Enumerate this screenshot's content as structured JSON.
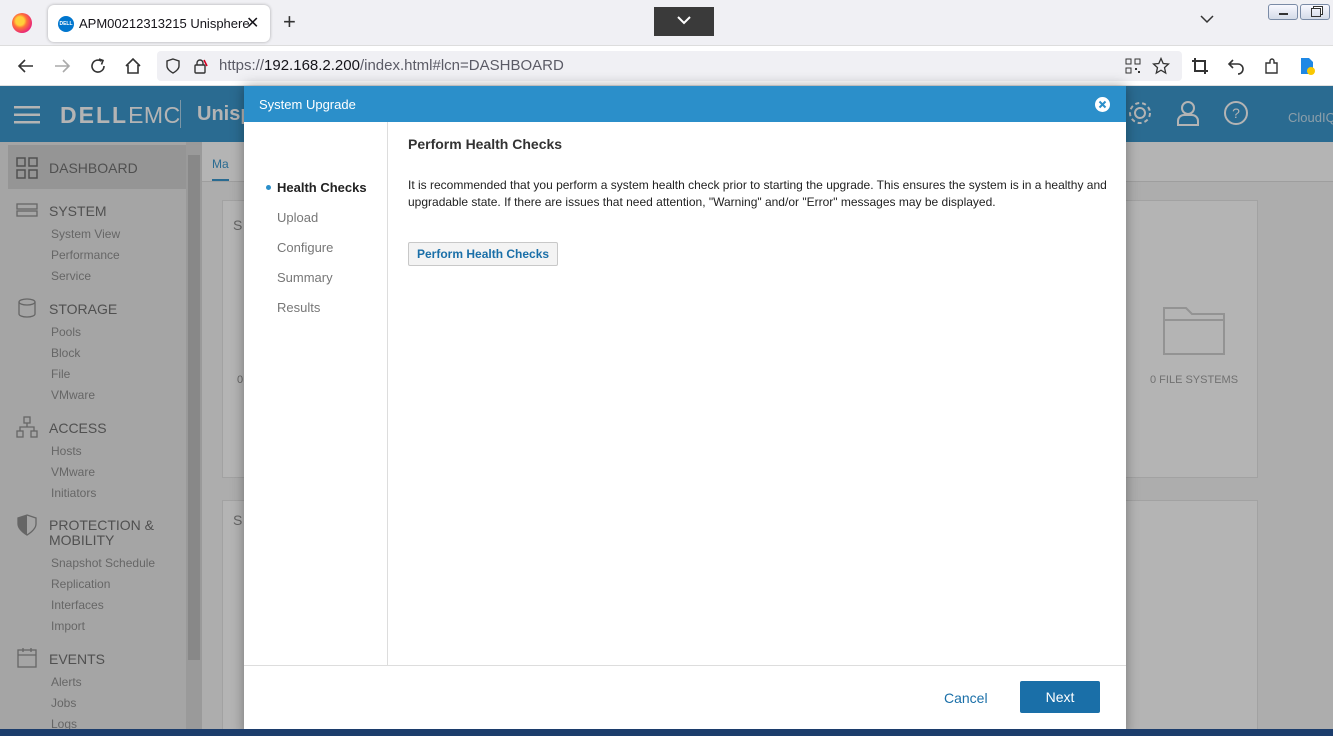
{
  "browser": {
    "tab_title": "APM00212313215 Unisphere",
    "tab_favicon_text": "DELL",
    "tab_close": "✕",
    "new_tab": "+",
    "url_prefix": "https://",
    "url_host": "192.168.2.200",
    "url_path": "/index.html#lcn=DASHBOARD"
  },
  "app": {
    "logo_bold": "DELL",
    "logo_light": "EMC",
    "title": "Unisp",
    "cloudiq": "CloudIQ",
    "main_tab": "Ma",
    "card_title_1": "S",
    "card_title_2": "S",
    "card_value_1": "0",
    "file_systems": "0  FILE SYSTEMS",
    "header_color": "#2b8fca"
  },
  "sidebar": {
    "sections": [
      {
        "label": "DASHBOARD",
        "icon": "dashboard-icon"
      },
      {
        "label": "SYSTEM",
        "icon": "server-icon",
        "items": [
          "System View",
          "Performance",
          "Service"
        ]
      },
      {
        "label": "STORAGE",
        "icon": "database-icon",
        "items": [
          "Pools",
          "Block",
          "File",
          "VMware"
        ]
      },
      {
        "label": "ACCESS",
        "icon": "network-icon",
        "items": [
          "Hosts",
          "VMware",
          "Initiators"
        ]
      },
      {
        "label": "PROTECTION &",
        "label2": "MOBILITY",
        "icon": "shield-icon",
        "items": [
          "Snapshot Schedule",
          "Replication",
          "Interfaces",
          "Import"
        ]
      },
      {
        "label": "EVENTS",
        "icon": "calendar-icon",
        "items": [
          "Alerts",
          "Jobs",
          "Logs"
        ]
      }
    ]
  },
  "modal": {
    "title": "System Upgrade",
    "steps": [
      "Health Checks",
      "Upload",
      "Configure",
      "Summary",
      "Results"
    ],
    "active_step": "Health Checks",
    "content_title": "Perform Health Checks",
    "description": "It is recommended that you perform a system health check prior to starting the upgrade. This ensures the system is in a healthy and upgradable state. If there are issues that need attention, \"Warning\" and/or \"Error\" messages may be displayed.",
    "health_button": "Perform Health Checks",
    "cancel": "Cancel",
    "next": "Next"
  }
}
